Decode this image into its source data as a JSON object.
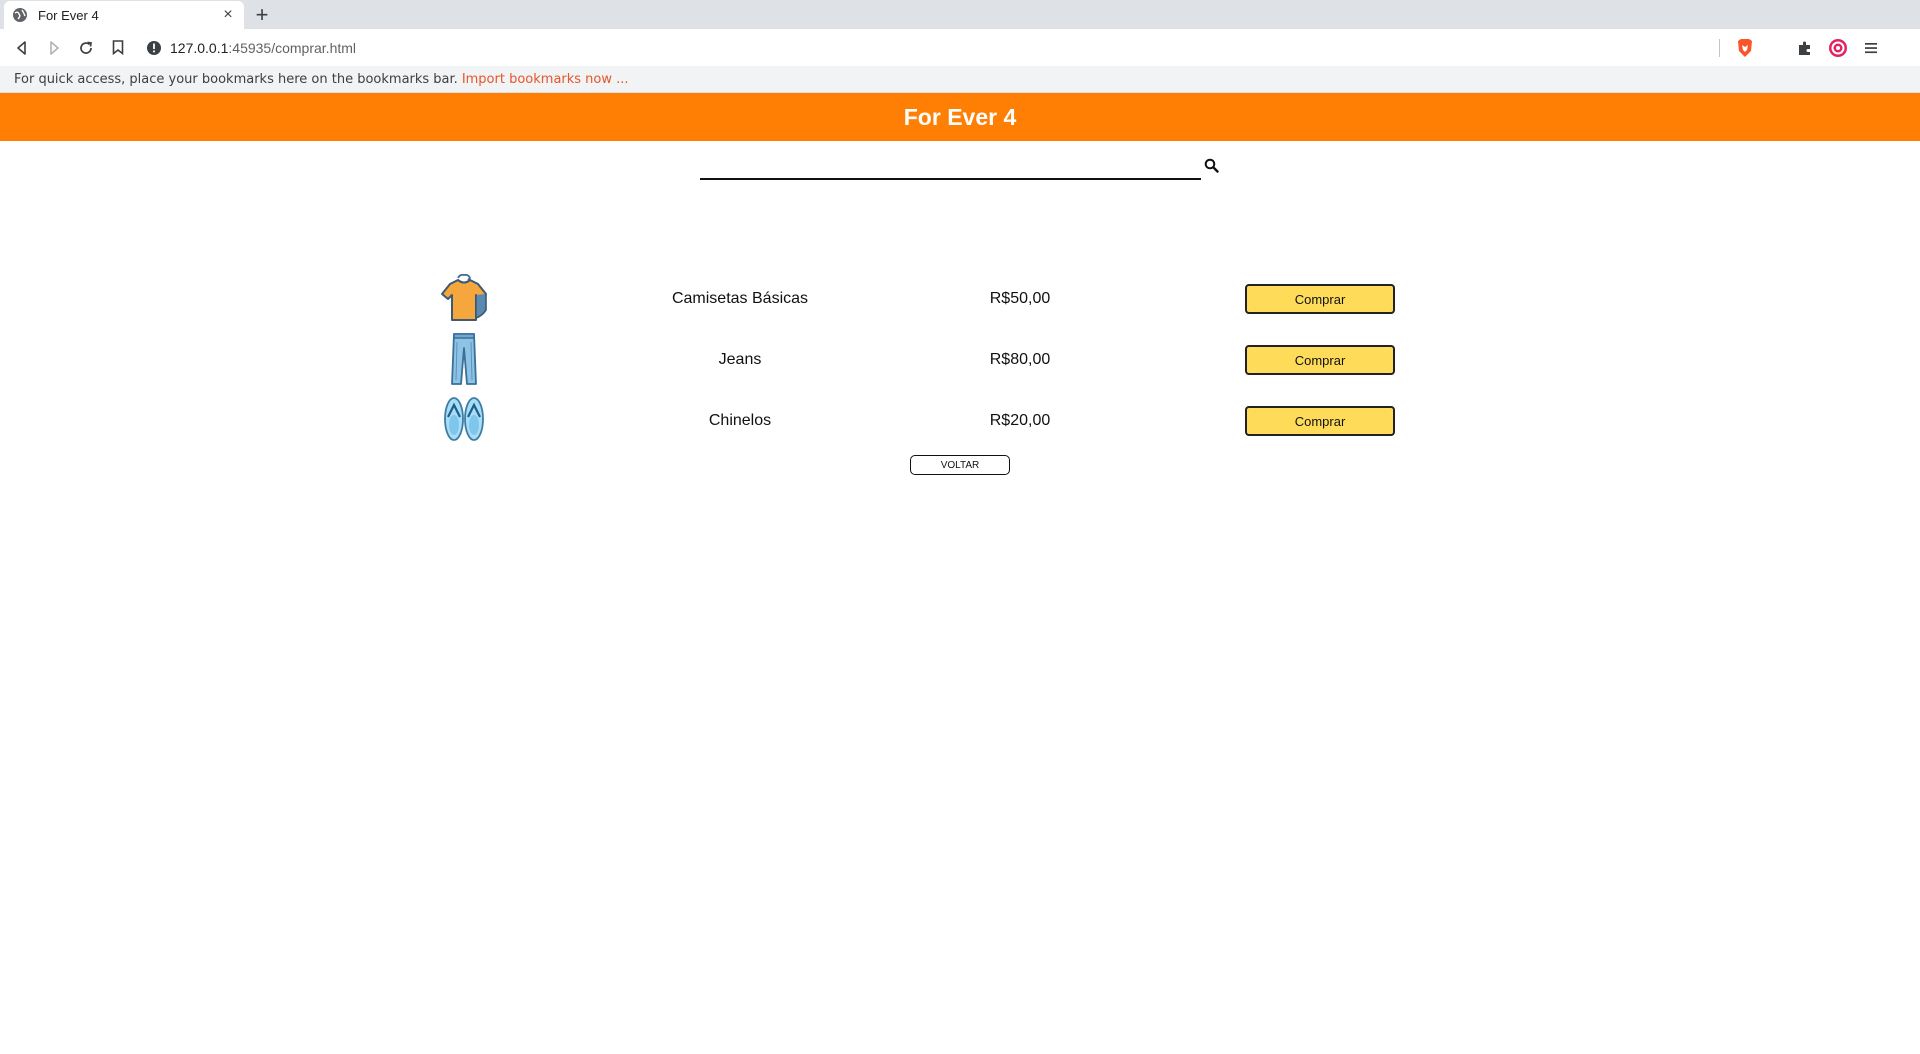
{
  "browser": {
    "tab_title": "For Ever 4",
    "new_tab_symbol": "+",
    "close_symbol": "×",
    "url_host": "127.0.0.1",
    "url_path": ":45935/comprar.html",
    "bookmarks_message": "For quick access, place your bookmarks here on the bookmarks bar.",
    "bookmarks_link": "Import bookmarks now ..."
  },
  "page": {
    "brand": "For Ever 4",
    "brand_color": "#ff7f04",
    "search_placeholder": "",
    "products": [
      {
        "icon": "tshirt-icon",
        "name": "Camisetas Básicas",
        "price": "R$50,00",
        "button": "Comprar"
      },
      {
        "icon": "jeans-icon",
        "name": "Jeans",
        "price": "R$80,00",
        "button": "Comprar"
      },
      {
        "icon": "flip-flops-icon",
        "name": "Chinelos",
        "price": "R$20,00",
        "button": "Comprar"
      }
    ],
    "back_button": "VOLTAR",
    "button_color": "#fedc5a"
  }
}
